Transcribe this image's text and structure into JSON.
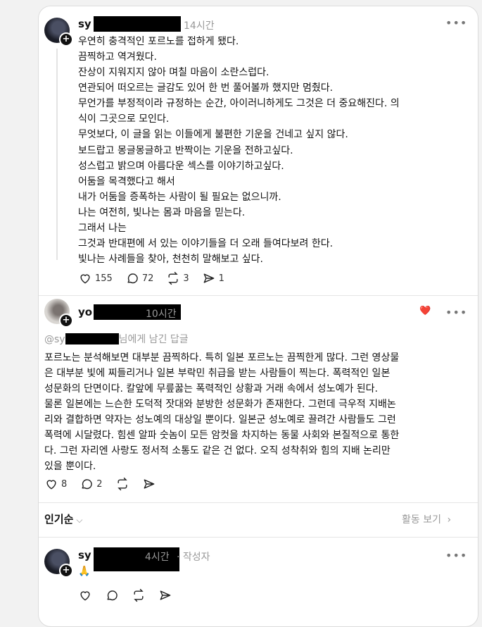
{
  "post1": {
    "username_prefix": "sy",
    "time": "14시간",
    "paragraph1": "우연히 충격적인 포르노를 접하게 됐다.\n끔찍하고 역겨웠다.\n잔상이 지워지지 않아 며칠 마음이 소란스럽다.\n연관되어 떠오르는 글감도 있어 한 번 풀어볼까 했지만 멈췄다.\n무언가를 부정적이라 규정하는 순간, 아이러니하게도 그것은 더 중요해진다. 의\n식이 그곳으로 모인다.\n무엇보다, 이 글을 읽는 이들에게 불편한 기운을 건네고 싶지 않다.",
    "paragraph2": "보드랍고 몽글몽글하고 반짝이는 기운을 전하고싶다.\n성스럽고 밝으며 아름다운 섹스를 이야기하고싶다.\n어둠을 목격했다고 해서\n내가 어둠을 증폭하는 사람이 될 필요는 없으니까.\n나는 여전히, 빛나는 몸과 마음을 믿는다.\n그래서 나는\n그것과 반대편에 서 있는 이야기들을 더 오래 들여다보려 한다.\n빛나는 사례들을 찾아, 천천히 말해보고 싶다.",
    "likes": "155",
    "comments": "72",
    "reposts": "3",
    "shares": "1"
  },
  "post2": {
    "username_prefix": "yo",
    "time": "10시간",
    "reply_prefix": "@sy",
    "reply_suffix": "님에게 남긴 답글",
    "text": "포르노는 분석해보면 대부분 끔찍하다. 특히 일본 포르노는 끔찍한게 많다. 그런 영상물\n은 대부분 빛에 찌들리거나 일본 부락민 취급을 받는 사람들이 찍는다. 폭력적인 일본\n성문화의 단면이다. 칼앞에 무릎꿇는 폭력적인 상황과 거래 속에서 성노예가 된다.\n물론 일본에는 느슨한 도덕적 잣대와 분방한 성문화가 존재한다. 그런데 극우적 지배논\n리와 결합하면 약자는 성노예의 대상일 뿐이다. 일본군 성노예로 끌려간 사람들도 그런\n폭력에 시달렸다. 힘센 알파 숫놈이 모든 암컷을 차지하는 동물 사회와 본질적으로 통한\n다. 그런 자리엔 사랑도 정서적 소통도 같은 건 없다. 오직 성착취와 힘의 지배 논리만\n있을 뿐이다.",
    "likes": "8",
    "comments": "2"
  },
  "sort": {
    "label": "인기순",
    "activity": "활동 보기"
  },
  "post3": {
    "username_prefix": "sy",
    "time": "4시간",
    "author_tag": "· 작성자",
    "emoji": "🙏"
  }
}
